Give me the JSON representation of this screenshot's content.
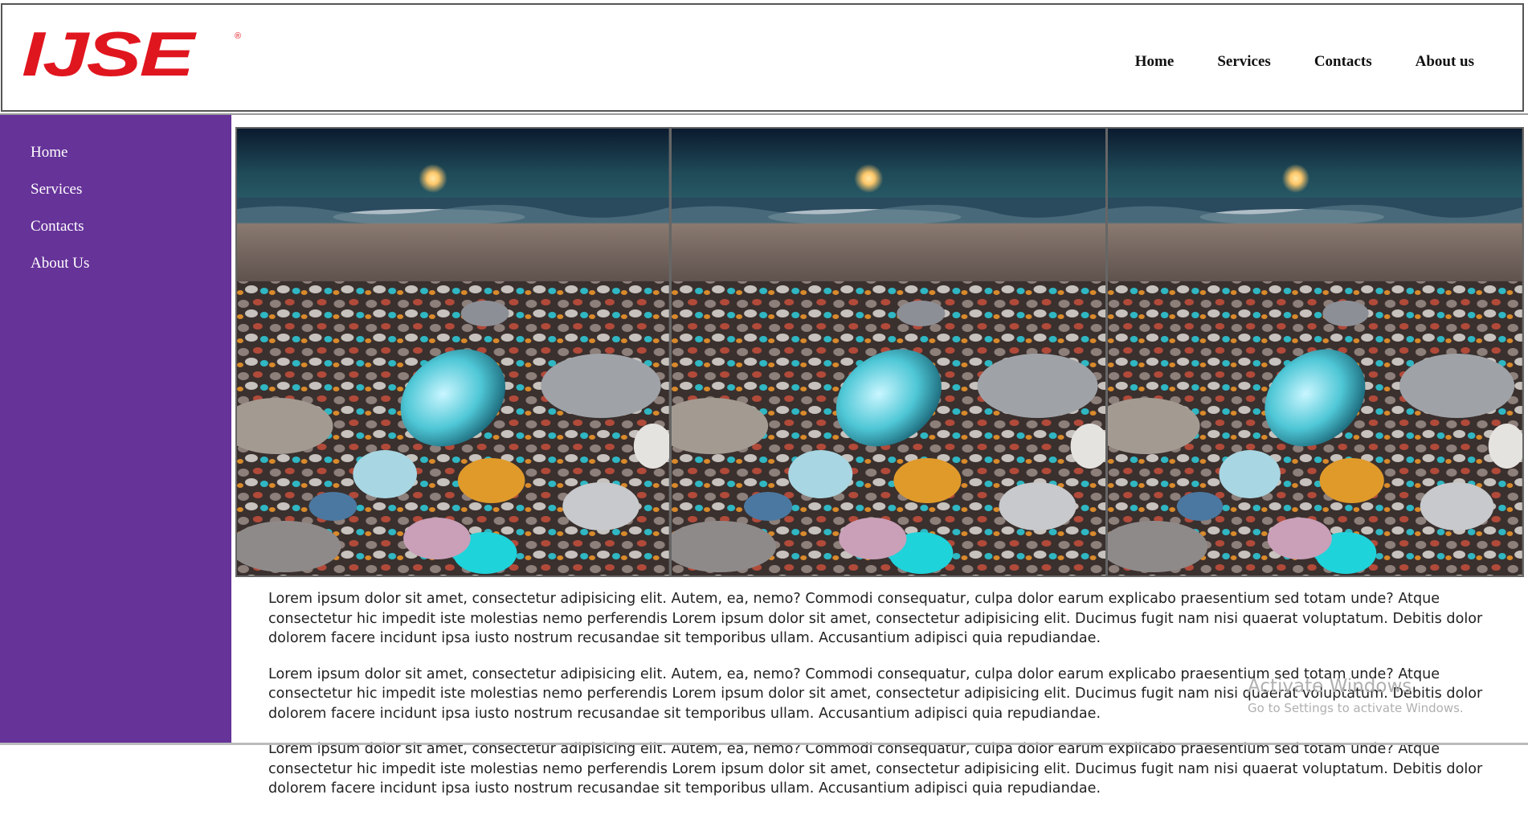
{
  "header": {
    "logo_text": "IJSE",
    "logo_mark": "®",
    "nav": [
      {
        "label": "Home"
      },
      {
        "label": "Services"
      },
      {
        "label": "Contacts"
      },
      {
        "label": "About us"
      }
    ]
  },
  "sidebar": {
    "items": [
      {
        "label": "Home"
      },
      {
        "label": "Services"
      },
      {
        "label": "Contacts"
      },
      {
        "label": "About Us"
      }
    ]
  },
  "gallery": {
    "images": [
      {
        "name": "glowing-pebble-beach-image"
      },
      {
        "name": "glowing-pebble-beach-image"
      },
      {
        "name": "glowing-pebble-beach-image"
      }
    ]
  },
  "content": {
    "paragraphs": [
      "Lorem ipsum dolor sit amet, consectetur adipisicing elit. Autem, ea, nemo? Commodi consequatur, culpa dolor earum explicabo praesentium sed totam unde? Atque consectetur hic impedit iste molestias nemo perferendis Lorem ipsum dolor sit amet, consectetur adipisicing elit. Ducimus fugit nam nisi quaerat voluptatum. Debitis dolor dolorem facere incidunt ipsa iusto nostrum recusandae sit temporibus ullam. Accusantium adipisci quia repudiandae.",
      "Lorem ipsum dolor sit amet, consectetur adipisicing elit. Autem, ea, nemo? Commodi consequatur, culpa dolor earum explicabo praesentium sed totam unde? Atque consectetur hic impedit iste molestias nemo perferendis Lorem ipsum dolor sit amet, consectetur adipisicing elit. Ducimus fugit nam nisi quaerat voluptatum. Debitis dolor dolorem facere incidunt ipsa iusto nostrum recusandae sit temporibus ullam. Accusantium adipisci quia repudiandae.",
      "Lorem ipsum dolor sit amet, consectetur adipisicing elit. Autem, ea, nemo? Commodi consequatur, culpa dolor earum explicabo praesentium sed totam unde? Atque consectetur hic impedit iste molestias nemo perferendis Lorem ipsum dolor sit amet, consectetur adipisicing elit. Ducimus fugit nam nisi quaerat voluptatum. Debitis dolor dolorem facere incidunt ipsa iusto nostrum recusandae sit temporibus ullam. Accusantium adipisci quia repudiandae."
    ]
  },
  "watermark": {
    "title": "Activate Windows",
    "subtitle": "Go to Settings to activate Windows."
  },
  "colors": {
    "brand_red": "#e0161f",
    "sidebar_purple": "#663399"
  }
}
